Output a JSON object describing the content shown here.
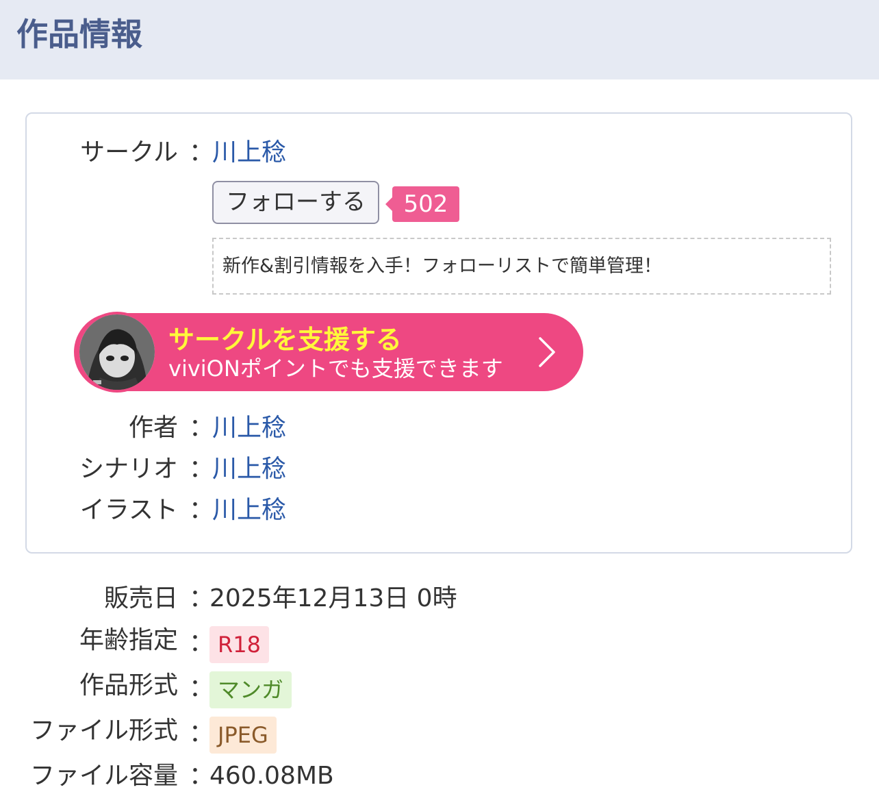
{
  "header": {
    "title": "作品情報"
  },
  "circle_box": {
    "circle_label": "サークル",
    "colon": "：",
    "circle_name": "川上稔",
    "follow_button": "フォローする",
    "follow_count": "502",
    "follow_note": "新作&割引情報を入手！フォローリストで簡単管理！",
    "support": {
      "title": "サークルを支援する",
      "subtitle": "viviONポイントでも支援できます",
      "color": "#ee4882",
      "title_color": "#fff83a"
    },
    "author_label": "作者",
    "author": "川上稔",
    "scenario_label": "シナリオ",
    "scenario": "川上稔",
    "illust_label": "イラスト",
    "illust": "川上稔"
  },
  "details": {
    "release_label": "販売日",
    "release_value": "2025年12月13日 0時",
    "age_label": "年齢指定",
    "age_value": "R18",
    "format_label": "作品形式",
    "format_value": "マンガ",
    "file_format_label": "ファイル形式",
    "file_format_value": "JPEG",
    "file_size_label": "ファイル容量",
    "file_size_value": "460.08MB"
  },
  "colors": {
    "link": "#2a59a8",
    "header_bg": "#e6eaf3",
    "header_text": "#4a5d8c",
    "age_tag_bg": "#fde2e6",
    "age_tag_text": "#d0213a",
    "format_tag_bg": "#e3f6d8",
    "format_tag_text": "#4f8a2a",
    "file_tag_bg": "#fde9d7",
    "file_tag_text": "#8a5a2a"
  }
}
